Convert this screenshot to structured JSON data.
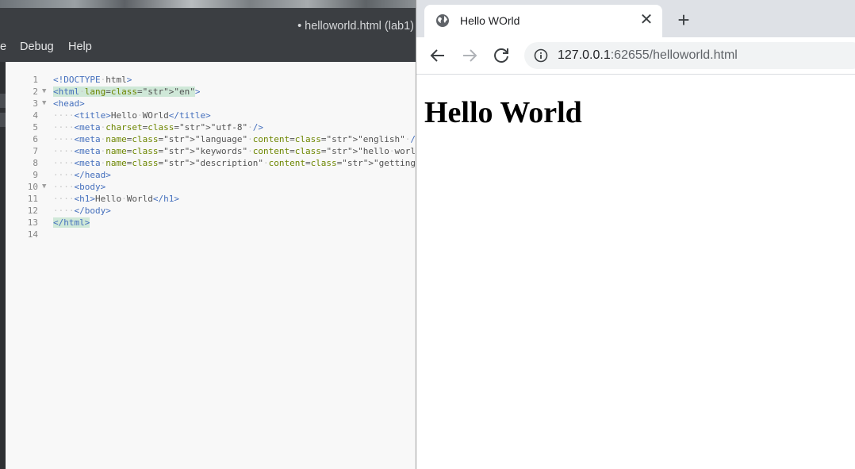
{
  "editor": {
    "title": "• helloworld.html (lab1)",
    "menu": [
      "e",
      "Debug",
      "Help"
    ],
    "lines": [
      {
        "num": "1",
        "fold": "",
        "code": "<!DOCTYPE·html>"
      },
      {
        "num": "2",
        "fold": "▼",
        "code": "<html·lang=\"en\">"
      },
      {
        "num": "3",
        "fold": "▼",
        "code": "<head>"
      },
      {
        "num": "4",
        "fold": "",
        "code": "····<title>Hello·WOrld</title>"
      },
      {
        "num": "5",
        "fold": "",
        "code": "····<meta·charset=\"utf-8\"·/>"
      },
      {
        "num": "6",
        "fold": "",
        "code": "····<meta·name=\"language\"·content=\"english\"·/>"
      },
      {
        "num": "7",
        "fold": "",
        "code": "····<meta·name=\"keywords\"·content=\"hello·world,lab,tasks\"·/>"
      },
      {
        "num": "8",
        "fold": "",
        "code": "····<meta·name=\"description\"·content=\"getting·started·task\"·/>"
      },
      {
        "num": "9",
        "fold": "",
        "code": "····</head>"
      },
      {
        "num": "10",
        "fold": "▼",
        "code": "····<body>"
      },
      {
        "num": "11",
        "fold": "",
        "code": "····<h1>Hello·World</h1>"
      },
      {
        "num": "12",
        "fold": "",
        "code": "····</body>"
      },
      {
        "num": "13",
        "fold": "",
        "code": "</html>"
      },
      {
        "num": "14",
        "fold": "",
        "code": ""
      }
    ]
  },
  "browser": {
    "tab_title": "Hello WOrld",
    "tab_close": "✕",
    "new_tab": "+",
    "url_host": "127.0.0.1",
    "url_path": ":62655/helloworld.html",
    "heading": "Hello World"
  },
  "icons": [
    "globe-icon",
    "close-icon",
    "plus-icon",
    "back-arrow-icon",
    "forward-arrow-icon",
    "reload-icon",
    "info-icon"
  ]
}
